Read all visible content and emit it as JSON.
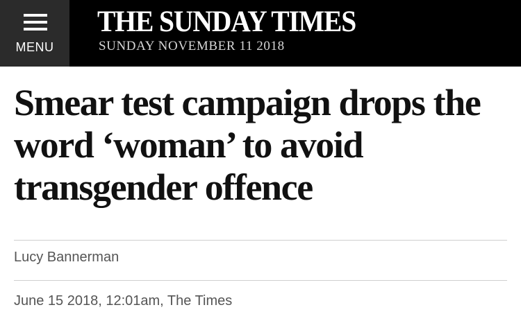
{
  "header": {
    "menu_label": "MENU",
    "menu_icon": "hamburger-menu-icon",
    "masthead": "THE SUNDAY TIMES",
    "edition_date": "SUNDAY NOVEMBER 11 2018",
    "background_color": "#000000",
    "menu_background_color": "#2b2b2b"
  },
  "article": {
    "headline": "Smear test campaign drops the word ‘woman’ to avoid transgender offence",
    "author": "Lucy Bannerman",
    "dateline": "June 15 2018, 12:01am, The Times"
  }
}
